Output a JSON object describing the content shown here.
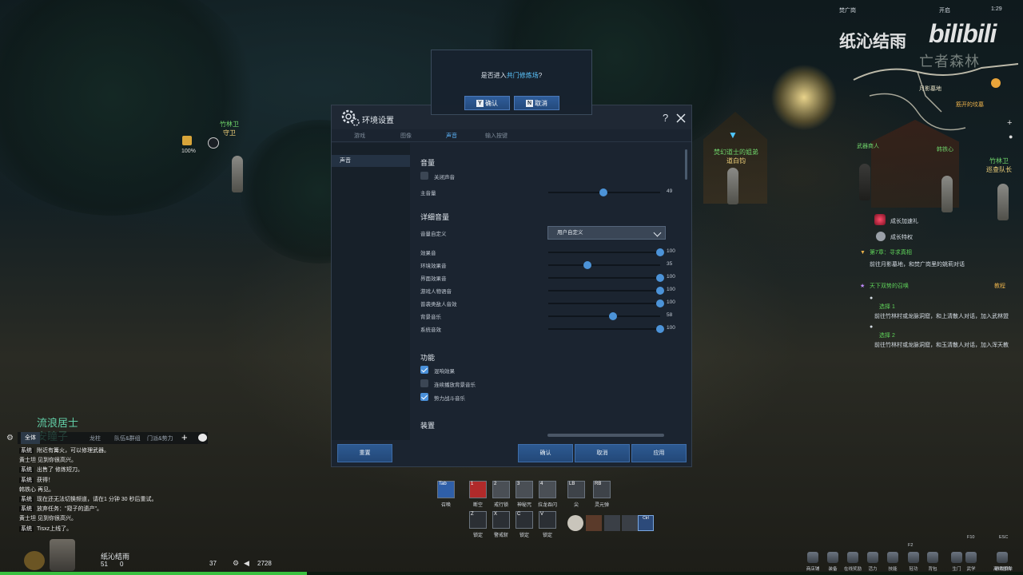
{
  "watermark": {
    "channel": "纸沁结雨",
    "bili": "bilibili"
  },
  "topbar": {
    "location": "焚广岗",
    "mode": "开启",
    "time": "1:29"
  },
  "minimap": {
    "area_name": "亡者森林",
    "labels": [
      "月影墓地",
      "竹林卫",
      "筋开的坟墓",
      "武器商人",
      "铁匠",
      "武器商人",
      "杂货商人",
      "禄龙工吉",
      "韩铁心"
    ]
  },
  "npcs": {
    "left_npc": {
      "title": "竹林卫",
      "name": "守卫"
    },
    "center_npc": {
      "title": "焚幻道士的姐弟",
      "name": "道白钧"
    },
    "right_npc": {
      "title": "竹林卫",
      "name": "巡查队长"
    },
    "left_percent": "100%"
  },
  "prompt": {
    "question_prefix": "是否进入",
    "question_highlight": "共门修炼场",
    "question_suffix": "?",
    "confirm_key": "Y",
    "confirm_label": "确认",
    "cancel_key": "N",
    "cancel_label": "取消"
  },
  "settings": {
    "title": "环境设置",
    "help": "?",
    "tabs": [
      "游戏",
      "图像",
      "声音",
      "输入按键"
    ],
    "active_tab": 2,
    "sidebar_item": "声音",
    "volume": {
      "title": "音量",
      "mute_label": "关闭声音",
      "mute_checked": false,
      "master_label": "主音量",
      "master_value": "49"
    },
    "detail": {
      "title": "详细音量",
      "preset_label": "音量自定义",
      "preset_value": "用户自定义",
      "sliders": [
        {
          "label": "效果音",
          "value": "100"
        },
        {
          "label": "环境效果音",
          "value": "35"
        },
        {
          "label": "界面效果音",
          "value": "100"
        },
        {
          "label": "游戏人物语音",
          "value": "100"
        },
        {
          "label": "普袭类敌人音效",
          "value": "100"
        },
        {
          "label": "背景音乐",
          "value": "58"
        },
        {
          "label": "系统音效",
          "value": "100"
        }
      ]
    },
    "features": {
      "title": "功能",
      "items": [
        {
          "label": "混响效果",
          "checked": true
        },
        {
          "label": "连续播放背景音乐",
          "checked": false
        },
        {
          "label": "势力战斗音乐",
          "checked": true
        }
      ]
    },
    "device_title": "装置",
    "buttons": {
      "reset": "重置",
      "confirm": "确认",
      "cancel": "取消",
      "apply": "应用"
    }
  },
  "quests": {
    "growth_1": "成长加速礼",
    "growth_2": "成长特权",
    "main_title": "第7章：寻求真相",
    "main_desc": "前往月影墓地，和焚广岗里的姚莉对话",
    "side_title": "天下双势的召唤",
    "side_tag": "教程",
    "choice1_title": "选择 1",
    "choice1_desc": "前往竹林村或龙脉洞窟，和上清散人对话，加入武林盟",
    "choice2_title": "选择 2",
    "choice2_desc": "前往竹林村或龙脉洞窟，和玉清散人对话，加入浑天教"
  },
  "chat": {
    "name_big_1": "流浪居士",
    "name_big_2": "安瞳子",
    "tabs": [
      "全体",
      "",
      "龙柱",
      "队伍&群组",
      "门派&势力"
    ],
    "lines": [
      {
        "ch": "系统",
        "text": "附近有篝火，可以修理武器。"
      },
      {
        "ch": "",
        "text": "黄士坦 见到你很高兴。"
      },
      {
        "ch": "系统",
        "text": "出售了 修炼短刀。"
      },
      {
        "ch": "系统",
        "text": "获得！"
      },
      {
        "ch": "",
        "text": "韩铁心 再见。"
      },
      {
        "ch": "系统",
        "text": "现在还无法切换频道，请在1 分钟 30 秒后重试。"
      },
      {
        "ch": "系统",
        "text": "放弃任务：\"窥子的遗产\"。"
      },
      {
        "ch": "",
        "text": "黄士坦 见到你很高兴。"
      },
      {
        "ch": "系统",
        "text": "Tisxz上线了。"
      }
    ]
  },
  "skills": {
    "row1": [
      {
        "key": "Tab",
        "label": "召唤"
      },
      {
        "key": "1",
        "label": "断空"
      },
      {
        "key": "2",
        "label": "戒行锁"
      },
      {
        "key": "3",
        "label": "神秘咒"
      },
      {
        "key": "4",
        "label": "拉龙吞闪"
      },
      {
        "key": "LB",
        "label": "尖"
      },
      {
        "key": "RB",
        "label": "灵元弹"
      }
    ],
    "row2": [
      {
        "key": "Z",
        "label": "锁定"
      },
      {
        "key": "X",
        "label": "警戒斩"
      },
      {
        "key": "C",
        "label": "锁定"
      },
      {
        "key": "V",
        "label": "锁定"
      }
    ],
    "hotkey_ctrl": "Ctrl"
  },
  "player": {
    "name": "纸沁结雨",
    "level": "51",
    "coins": "0",
    "gems": "37",
    "currency": "2728"
  },
  "menu": [
    "商店铺",
    "装备",
    "在线奖励",
    "活力",
    "技能",
    "轻功",
    "背包",
    "生门",
    "武学",
    "离线挂机",
    "游戏菜单"
  ],
  "menu_keys": {
    "f2": "F2",
    "f10": "F10",
    "esc": "ESC"
  },
  "progress": {
    "xp_fraction": 0.3
  },
  "colors": {
    "accent": "#4c93d8",
    "quest_green": "#5fd35a",
    "xp_green": "#39c03f"
  }
}
